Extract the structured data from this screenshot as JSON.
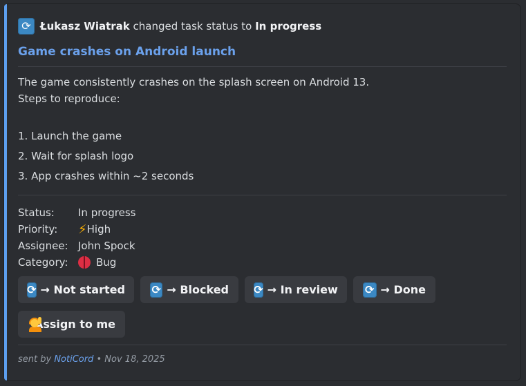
{
  "author": {
    "name": "Łukasz Wiatrak",
    "action": "changed task status to",
    "status": "In progress"
  },
  "title": "Game crashes on Android launch",
  "description": {
    "line1": "The game consistently crashes on the splash screen on Android 13.",
    "line2": "Steps to reproduce:",
    "steps": [
      "1. Launch the game",
      "2. Wait for splash logo",
      "3. App crashes within ~2 seconds"
    ]
  },
  "fields": {
    "status_label": "Status:",
    "status_value": "In progress",
    "priority_label": "Priority:",
    "priority_value": "High",
    "assignee_label": "Assignee:",
    "assignee_value": "John Spock",
    "category_label": "Category:",
    "category_value": "Bug"
  },
  "buttons": {
    "not_started": "→ Not started",
    "blocked": "→ Blocked",
    "in_review": "→ In review",
    "done": "→ Done",
    "assign": "Assign to me"
  },
  "footer": {
    "prefix": "sent by",
    "app": "NotiCord",
    "separator": "•",
    "date": "Nov 18, 2025"
  },
  "colors": {
    "accent": "#5d9ff0",
    "link": "#6ba1ec",
    "background": "#2b2d31",
    "button": "#393b40"
  },
  "icons": {
    "status": "sync-icon",
    "priority": "lightning-icon",
    "category": "ladybug-icon",
    "assign": "person-raising-hand-icon"
  }
}
